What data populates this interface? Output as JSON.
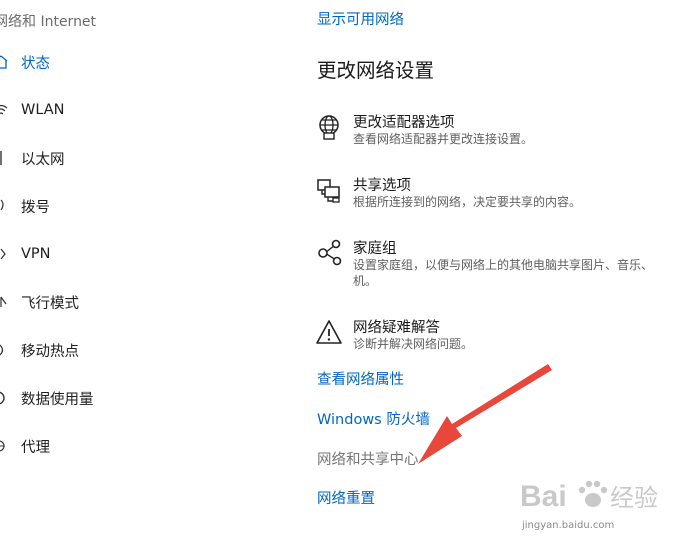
{
  "sidebar": {
    "title": "网络和 Internet",
    "items": [
      {
        "label": "状态",
        "icon": "home-icon",
        "active": true
      },
      {
        "label": "WLAN",
        "icon": "wifi-icon"
      },
      {
        "label": "以太网",
        "icon": "ethernet-icon"
      },
      {
        "label": "拨号",
        "icon": "dialup-icon"
      },
      {
        "label": "VPN",
        "icon": "vpn-icon"
      },
      {
        "label": "飞行模式",
        "icon": "airplane-icon"
      },
      {
        "label": "移动热点",
        "icon": "hotspot-icon"
      },
      {
        "label": "数据使用量",
        "icon": "data-usage-icon"
      },
      {
        "label": "代理",
        "icon": "globe-icon"
      }
    ]
  },
  "main": {
    "top_link": "显示可用网络",
    "section_heading": "更改网络设置",
    "options": [
      {
        "title": "更改适配器选项",
        "desc": "查看网络适配器并更改连接设置。",
        "icon": "adapter-globe-icon"
      },
      {
        "title": "共享选项",
        "desc": "根据所连接到的网络，决定要共享的内容。",
        "icon": "sharing-icon"
      },
      {
        "title": "家庭组",
        "desc": "设置家庭组，以便与网络上的其他电脑共享图片、音乐、机。",
        "icon": "homegroup-icon"
      },
      {
        "title": "网络疑难解答",
        "desc": "诊断并解决网络问题。",
        "icon": "warning-icon"
      }
    ],
    "links": [
      {
        "label": "查看网络属性",
        "muted": false
      },
      {
        "label": "Windows 防火墙",
        "muted": false
      },
      {
        "label": "网络和共享中心",
        "muted": true
      },
      {
        "label": "网络重置",
        "muted": false
      }
    ]
  },
  "overlay": {
    "arrow_color": "#e8473c",
    "watermark_brand": "Baidu经验",
    "watermark_url": "jingyan.baidu.com"
  },
  "colors": {
    "accent": "#0067c0",
    "text": "#1f1f1f",
    "muted": "#767676"
  }
}
